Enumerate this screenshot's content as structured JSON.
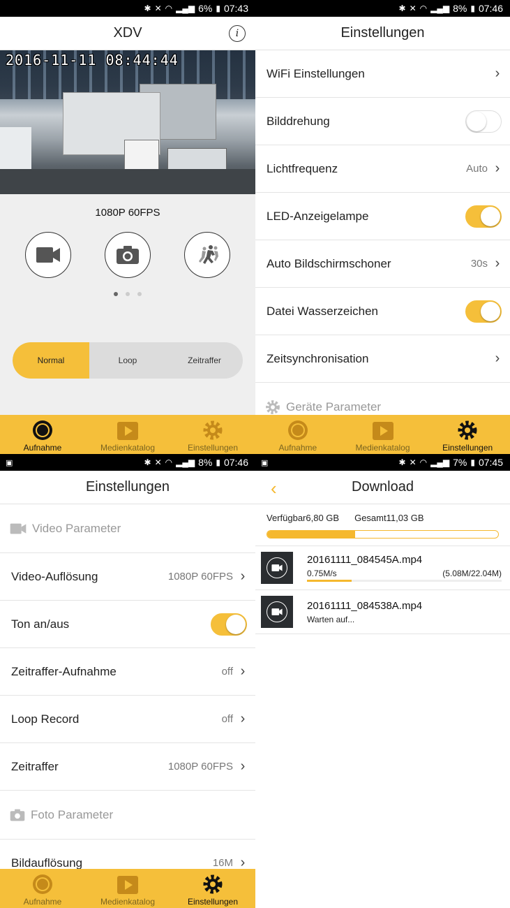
{
  "status_bars": [
    {
      "battery": "6%",
      "time": "07:43"
    },
    {
      "battery": "8%",
      "time": "07:46"
    },
    {
      "battery": "8%",
      "time": "07:46"
    },
    {
      "battery": "7%",
      "time": "07:45"
    }
  ],
  "camera": {
    "title": "XDV",
    "timestamp": "2016-11-11  08:44:44",
    "resolution": "1080P 60FPS",
    "modes": [
      "Normal",
      "Loop",
      "Zeitraffer"
    ],
    "active_mode": "Normal"
  },
  "nav": {
    "aufnahme": "Aufnahme",
    "medienkatalog": "Medienkatalog",
    "einstellungen": "Einstellungen"
  },
  "settings1": {
    "title": "Einstellungen",
    "wifi": "WiFi Einstellungen",
    "bilddrehung": "Bilddrehung",
    "lichtfrequenz": "Lichtfrequenz",
    "lichtfrequenz_value": "Auto",
    "led": "LED-Anzeigelampe",
    "screensaver": "Auto Bildschirmschoner",
    "screensaver_value": "30s",
    "watermark": "Datei Wasserzeichen",
    "timesync": "Zeitsynchronisation",
    "device_section": "Geräte Parameter"
  },
  "settings2": {
    "title": "Einstellungen",
    "video_section": "Video Parameter",
    "video_res": "Video-Auflösung",
    "video_res_value": "1080P 60FPS",
    "sound": "Ton an/aus",
    "timelapse_rec": "Zeitraffer-Aufnahme",
    "timelapse_rec_value": "off",
    "loop": "Loop Record",
    "loop_value": "off",
    "timelapse": "Zeitraffer",
    "timelapse_value": "1080P 60FPS",
    "photo_section": "Foto Parameter",
    "photo_res": "Bildauflösung",
    "photo_res_value": "16M"
  },
  "download": {
    "title": "Download",
    "available": "Verfügbar6,80 GB",
    "total": "Gesamt11,03 GB",
    "used_fraction": 0.38,
    "items": [
      {
        "name": "20161111_084545A.mp4",
        "status": "0.75M/s",
        "size": "(5.08M/22.04M)",
        "progress": 0.23
      },
      {
        "name": "20161111_084538A.mp4",
        "status": "Warten auf..."
      }
    ]
  },
  "colors": {
    "accent": "#f5bf3a",
    "background": "#efefef"
  }
}
